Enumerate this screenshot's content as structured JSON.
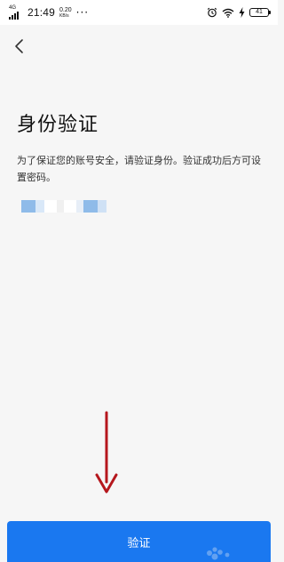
{
  "status_bar": {
    "network_type": "4G",
    "time": "21:49",
    "net_speed_value": "0.20",
    "net_speed_unit": "KB/s",
    "more_indicator": "···",
    "battery_level": "41",
    "icons": [
      "signal-icon",
      "alarm-icon",
      "wifi-icon",
      "charging-icon",
      "battery-icon"
    ]
  },
  "header": {
    "back_icon": "chevron-left-icon"
  },
  "main": {
    "title": "身份验证",
    "description": "为了保证您的账号安全，请验证身份。验证成功后方可设置密码。",
    "masked_account_colors": [
      "#8fbbe9",
      "#d9e8f8",
      "#ffffff",
      "#f0f0f0",
      "#ffffff",
      "#e7eef7",
      "#8fbbe9",
      "#cfe1f5"
    ]
  },
  "annotation": {
    "arrow_color": "#b5171d",
    "points_to": "verify-button"
  },
  "footer": {
    "verify_label": "验证"
  },
  "colors": {
    "primary": "#1a78f0",
    "background": "#f6f6f6",
    "status_bar_bg": "#ffffff"
  }
}
